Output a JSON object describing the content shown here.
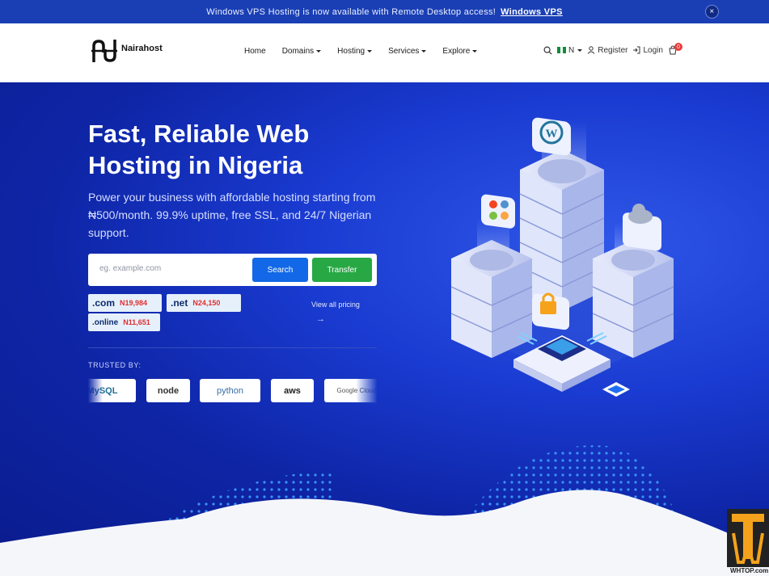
{
  "announcement": {
    "text": "Windows VPS Hosting is now available with Remote Desktop access!",
    "link": "Windows VPS",
    "close": "×"
  },
  "header": {
    "brand": "Nairahost",
    "nav": [
      {
        "label": "Home",
        "dropdown": false
      },
      {
        "label": "Domains",
        "dropdown": true
      },
      {
        "label": "Hosting",
        "dropdown": true
      },
      {
        "label": "Services",
        "dropdown": true
      },
      {
        "label": "Explore",
        "dropdown": true
      }
    ],
    "currency": "N",
    "register": "Register",
    "login": "Login",
    "cart_count": "0"
  },
  "hero": {
    "title": "Fast, Reliable Web Hosting in Nigeria",
    "lead": "Power your business with affordable hosting starting from ₦500/month. 99.9% uptime, free SSL, and 24/7 Nigerian support.",
    "search_placeholder": "eg. example.com",
    "search_button": "Search",
    "transfer_button": "Transfer",
    "tlds": [
      {
        "name": ".com",
        "price": "N19,984"
      },
      {
        "name": ".net",
        "price": "N24,150"
      },
      {
        "name": ".online",
        "price": "N11,651"
      }
    ],
    "view_all": "View all pricing",
    "trusted_label": "TRUSTED BY:",
    "trusted_logos": [
      "MySQL",
      "node",
      "python",
      "aws",
      "Google Cloud"
    ]
  },
  "watermark": "WHTOP.com",
  "colors": {
    "primary": "#1a3fb5",
    "search": "#1268e6",
    "transfer": "#27a844",
    "price": "#e02f2f"
  }
}
